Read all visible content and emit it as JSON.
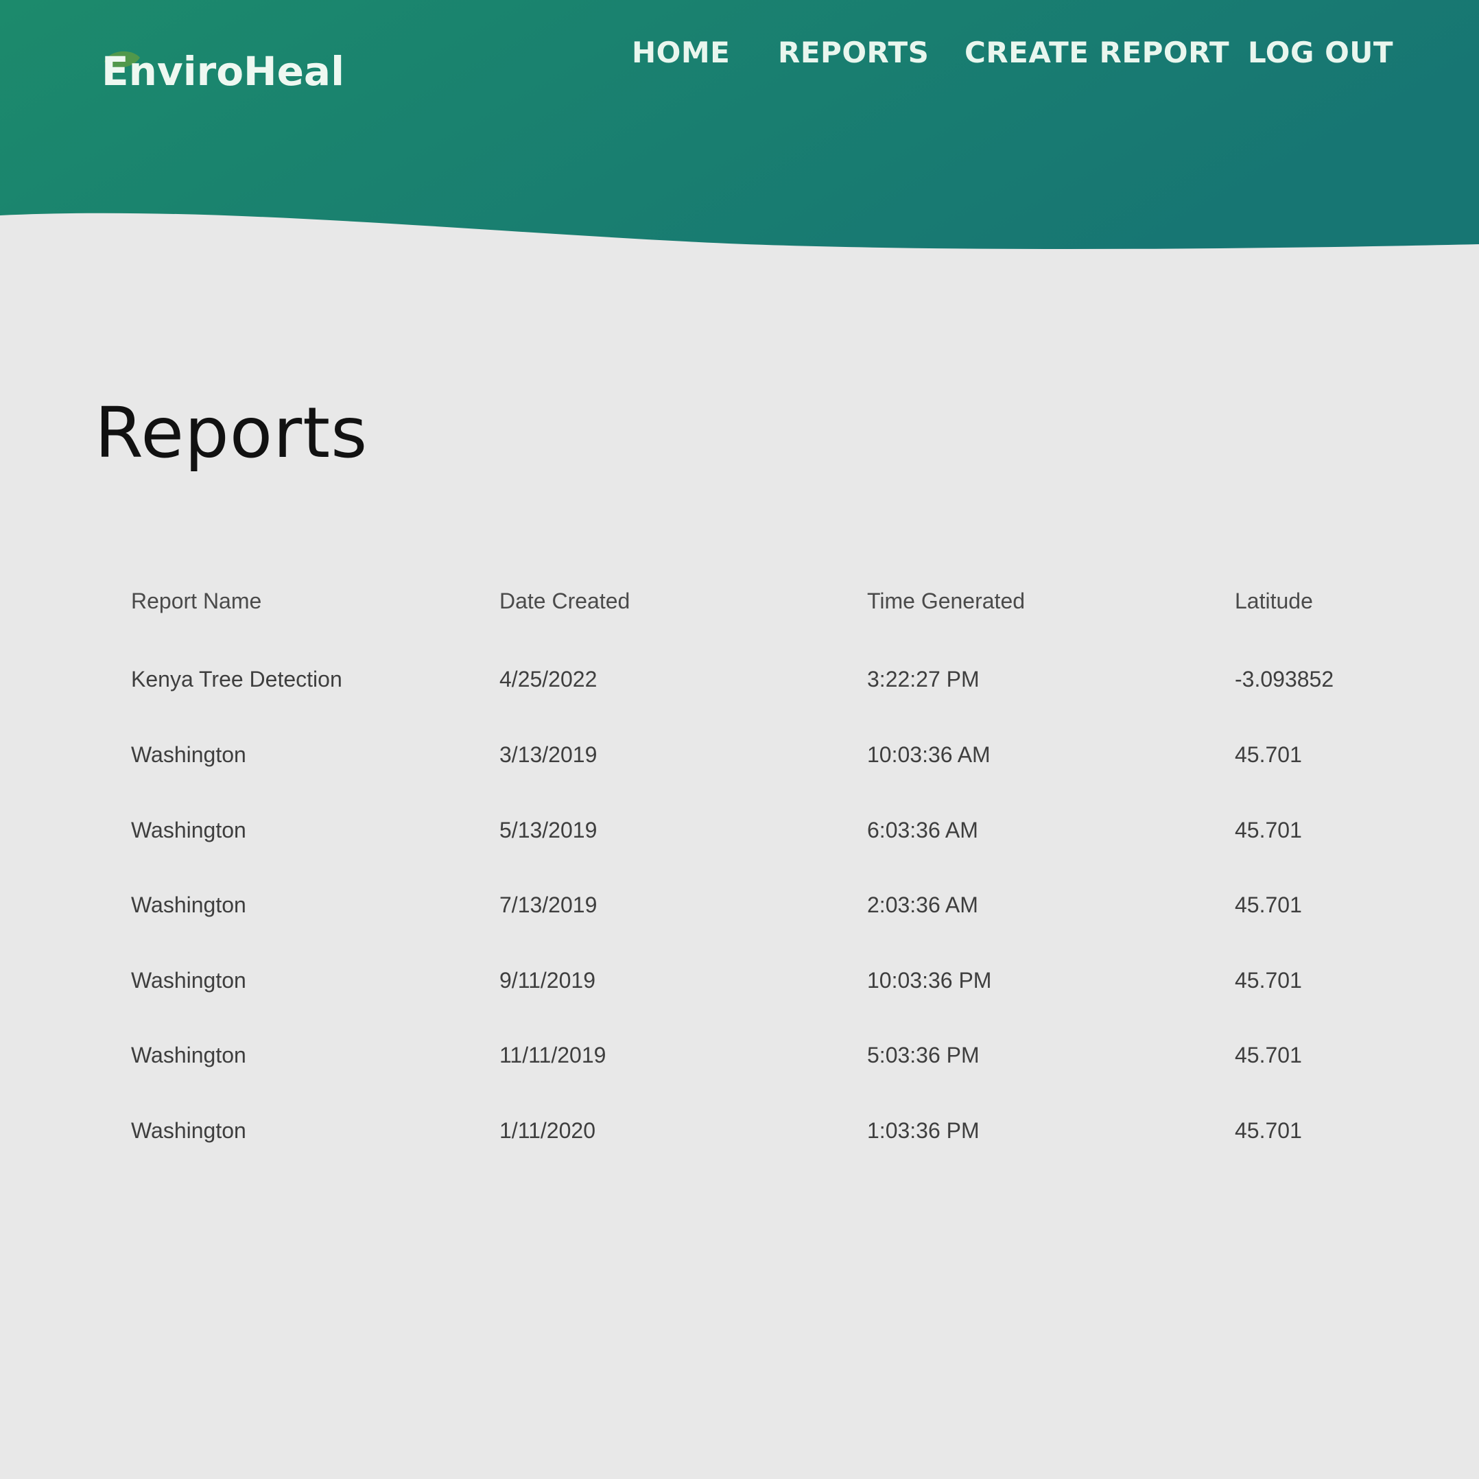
{
  "brand": {
    "name": "EnviroHeal"
  },
  "nav": {
    "items": [
      {
        "label": "HOME"
      },
      {
        "label": "REPORTS"
      },
      {
        "label": "CREATE REPORT"
      },
      {
        "label": "LOG OUT"
      }
    ]
  },
  "page": {
    "title": "Reports"
  },
  "colors": {
    "header_gradient_start": "#1c8a6c",
    "header_gradient_end": "#177673",
    "background": "#e8e8e8",
    "nav_text": "#e9f6ee",
    "leaf": "#5a9b45"
  },
  "table": {
    "columns": [
      "Report Name",
      "Date Created",
      "Time Generated",
      "Latitude"
    ],
    "rows": [
      [
        "Kenya Tree Detection",
        "4/25/2022",
        "3:22:27 PM",
        "-3.093852"
      ],
      [
        "Washington",
        "3/13/2019",
        "10:03:36 AM",
        "45.701"
      ],
      [
        "Washington",
        "5/13/2019",
        "6:03:36 AM",
        "45.701"
      ],
      [
        "Washington",
        "7/13/2019",
        "2:03:36 AM",
        "45.701"
      ],
      [
        "Washington",
        "9/11/2019",
        "10:03:36 PM",
        "45.701"
      ],
      [
        "Washington",
        "11/11/2019",
        "5:03:36 PM",
        "45.701"
      ],
      [
        "Washington",
        "1/11/2020",
        "1:03:36 PM",
        "45.701"
      ]
    ]
  }
}
